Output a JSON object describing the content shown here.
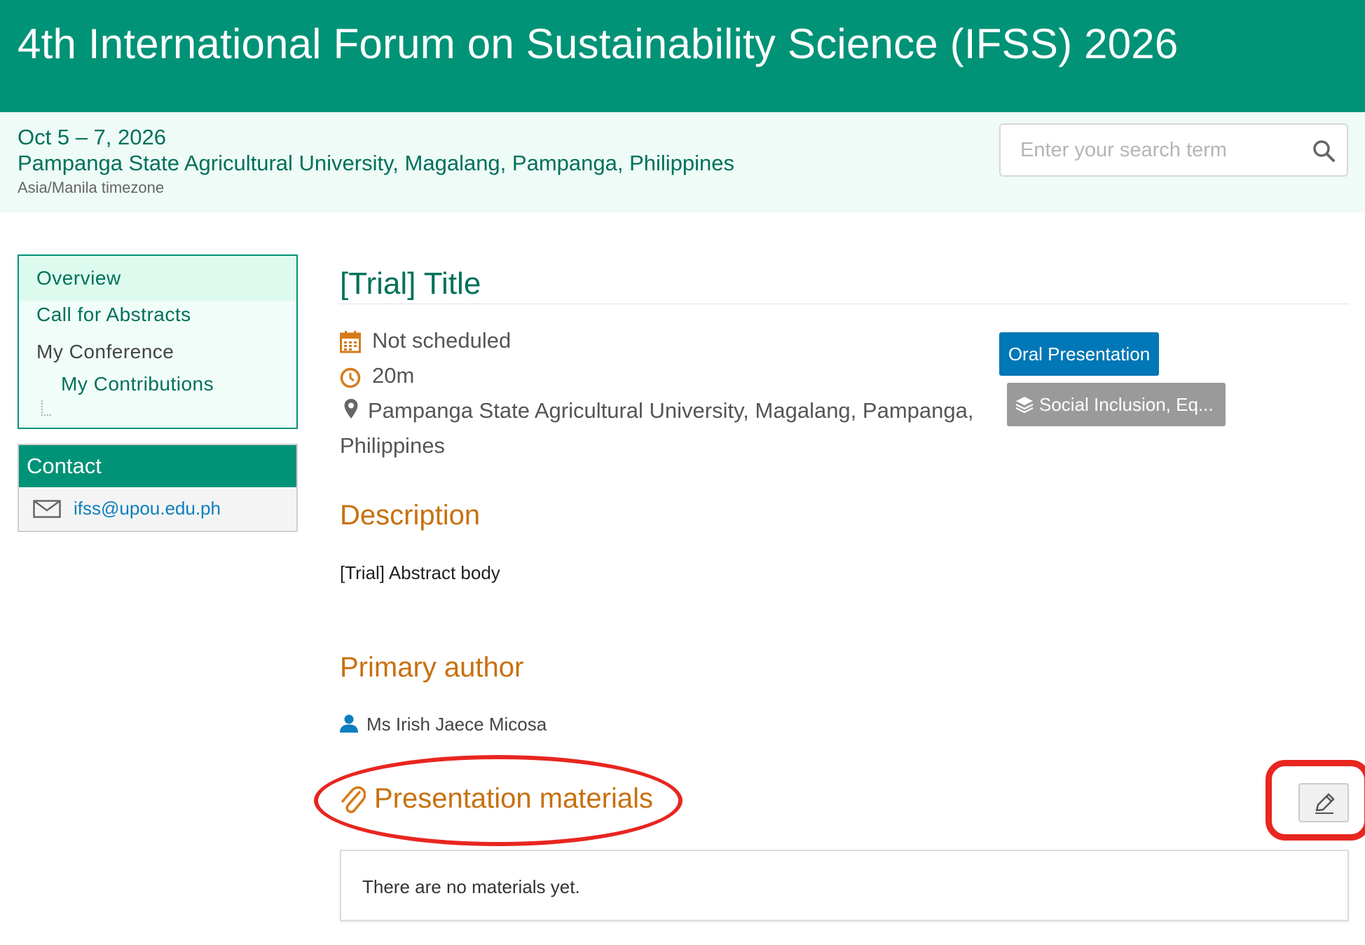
{
  "header": {
    "title": "4th International Forum on Sustainability Science (IFSS) 2026",
    "background_color": "#019377"
  },
  "event": {
    "dates": "Oct 5 – 7, 2026",
    "venue": "Pampanga State Agricultural University, Magalang, Pampanga, Philippines",
    "timezone": "Asia/Manila timezone"
  },
  "search": {
    "placeholder": "Enter your search term",
    "value": "",
    "icon": "search-icon"
  },
  "menu": {
    "items": [
      {
        "label": "Overview",
        "active": true
      },
      {
        "label": "Call for Abstracts",
        "active": false
      },
      {
        "label": "My Conference",
        "active": false
      },
      {
        "label": "My Contributions",
        "active": false,
        "sub_item": true
      }
    ]
  },
  "contact": {
    "heading": "Contact",
    "email": "ifss@upou.edu.ph",
    "icon": "envelope-icon"
  },
  "contribution": {
    "title": "[Trial] Title",
    "schedule": "Not scheduled",
    "duration": "20m",
    "location": "Pampanga State Agricultural University, Magalang, Pampanga,",
    "location_line2": "Philippines",
    "type_badge": "Oral Presentation",
    "track_badge": "Social Inclusion, Eq...",
    "description_heading": "Description",
    "description": "[Trial] Abstract body",
    "primary_author_heading": "Primary author",
    "primary_author": "Ms Irish Jaece Micosa",
    "materials_heading": "Presentation materials",
    "materials_empty": "There are no materials yet."
  },
  "colors": {
    "accent_green": "#019377",
    "heading_orange": "#c8700e",
    "badge_blue": "#0077b6",
    "badge_gray": "#9a9a9a",
    "annotation_red": "#e8261f"
  }
}
